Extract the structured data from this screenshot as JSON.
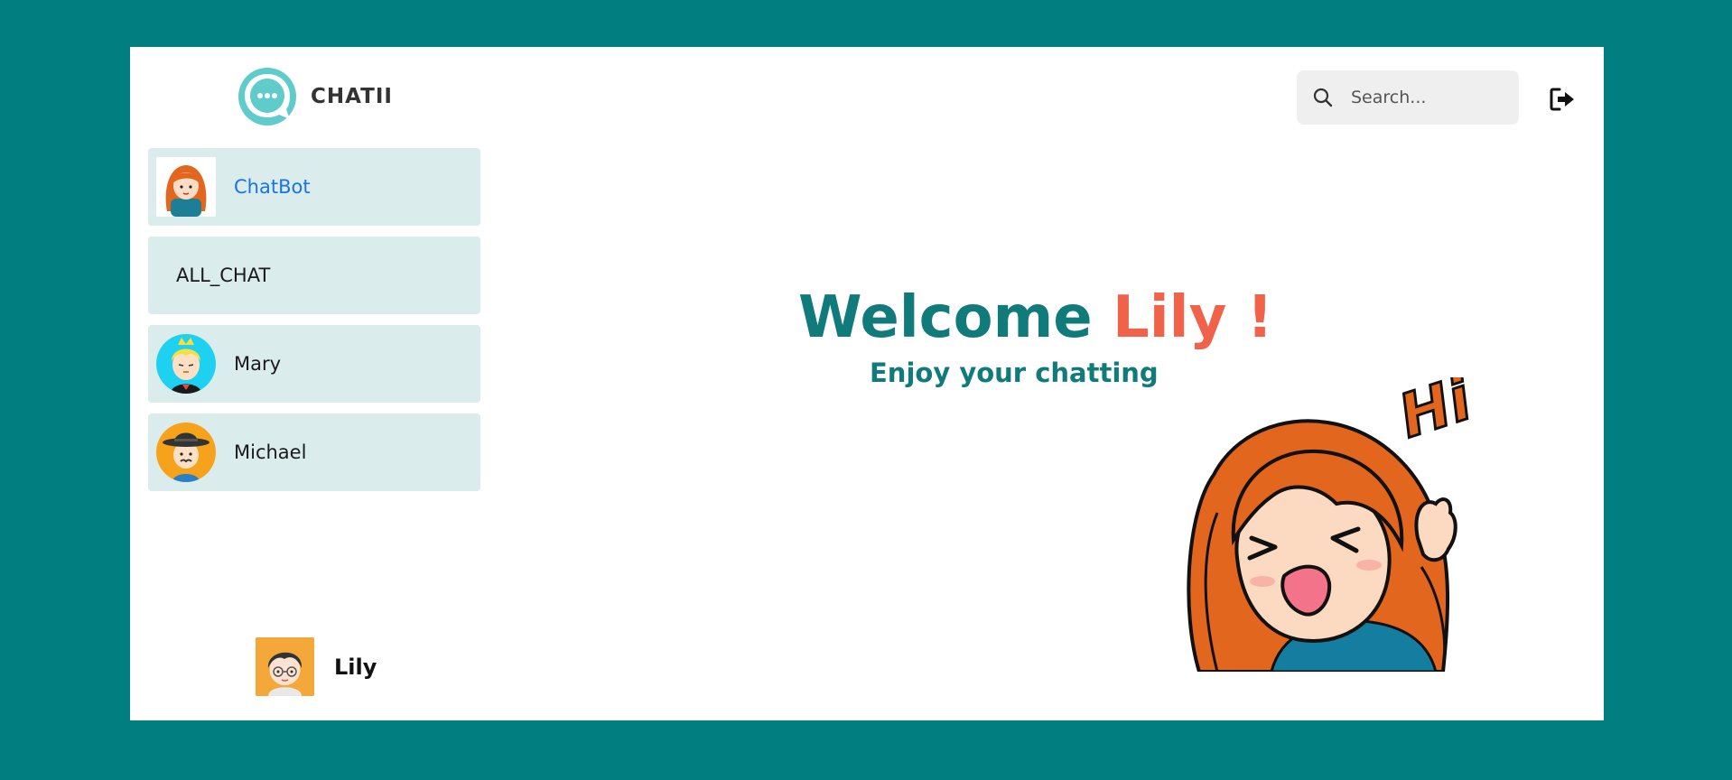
{
  "app": {
    "name": "CHATII"
  },
  "search": {
    "placeholder": "Search..."
  },
  "contacts": [
    {
      "name": "ChatBot",
      "avatar": "chatbot-girl-avatar"
    },
    {
      "name": "ALL_CHAT"
    },
    {
      "name": "Mary",
      "avatar": "mary-avatar"
    },
    {
      "name": "Michael",
      "avatar": "michael-avatar"
    }
  ],
  "welcome": {
    "prefix": "Welcome",
    "name": "Lily !",
    "subtitle": "Enjoy your chatting",
    "illustration_text": "Hi"
  },
  "current_user": {
    "name": "Lily",
    "avatar": "lily-avatar"
  },
  "colors": {
    "background": "#017f80",
    "accent_teal": "#117a7a",
    "accent_coral": "#f0624a",
    "contact_bg": "#daecec"
  },
  "icons": {
    "logo": "chat-bubble-icon",
    "search": "search-icon",
    "logout": "logout-icon"
  }
}
